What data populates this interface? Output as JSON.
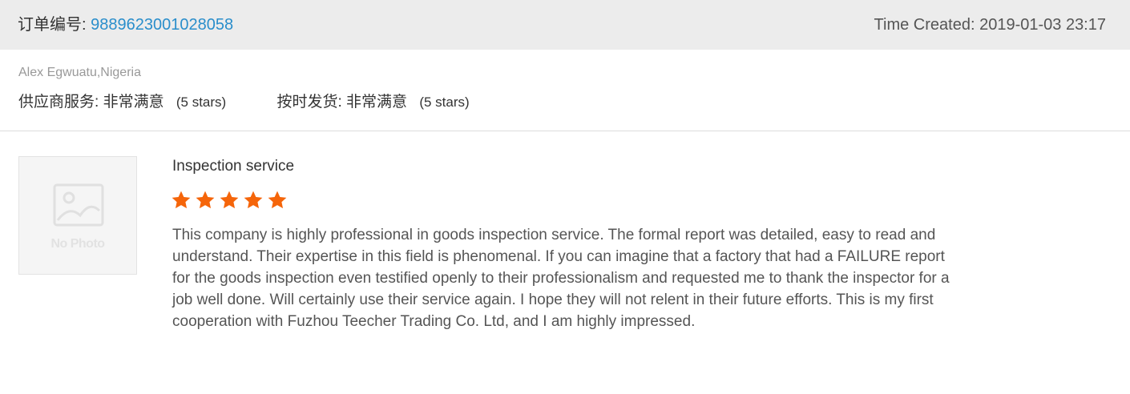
{
  "order": {
    "number_label": "订单编号:",
    "number_value": "9889623001028058",
    "time_label": "Time Created:",
    "time_value": "2019-01-03 23:17"
  },
  "buyer": {
    "name": "Alex Egwuatu,Nigeria"
  },
  "ratings": [
    {
      "label": "供应商服务:",
      "value": "非常满意",
      "stars_text": "(5 stars)",
      "stars": 5
    },
    {
      "label": "按时发货:",
      "value": "非常满意",
      "stars_text": "(5 stars)",
      "stars": 5
    }
  ],
  "review": {
    "photo_placeholder": "No Photo",
    "photo_icon": "image-placeholder-icon",
    "title": "Inspection service",
    "star_rating": 5,
    "star_color": "#f5650a",
    "body": "This company is highly professional in goods inspection service. The formal report was detailed, easy to read and understand. Their expertise in this field is phenomenal. If you can imagine that a factory that had a FAILURE report for the goods inspection even testified openly to their professionalism and requested me to thank the inspector for a job well done. Will certainly use their service again. I hope they will not relent in their future efforts. This is my first cooperation with Fuzhou Teecher Trading Co. Ltd, and I am highly impressed."
  },
  "colors": {
    "header_bg": "#ececec",
    "link": "#2a8ecb",
    "star": "#f5650a"
  }
}
